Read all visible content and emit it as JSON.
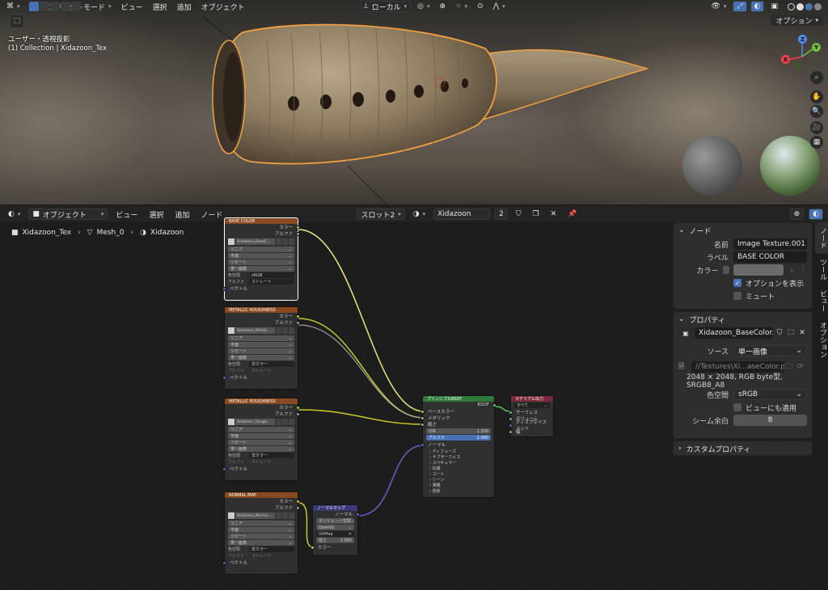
{
  "viewport": {
    "header": {
      "mode": "オブジェクトモード",
      "menus": [
        "ビュー",
        "選択",
        "追加",
        "オブジェクト"
      ],
      "transform_orientation": "ローカル",
      "options": "オプション"
    },
    "view_label": "ユーザー・透視投影",
    "collection_label": "(1) Collection | Xidazoon_Tex",
    "gizmo": {
      "x": "X",
      "y": "Y",
      "z": "Z"
    }
  },
  "node_editor": {
    "header": {
      "editor_type": "オブジェクト",
      "menus": [
        "ビュー",
        "選択",
        "追加",
        "ノード"
      ],
      "slot": "スロット2",
      "material": "Xidazoon",
      "users": "2"
    },
    "breadcrumb": [
      "Xidazoon_Tex",
      "Mesh_0",
      "Xidazoon"
    ],
    "texture_nodes": [
      {
        "title": "BASE COLOR",
        "image": "Xidazoon_BaseC...",
        "colorspace": "sRGB",
        "alpha": "ストレート"
      },
      {
        "title": "METALLIC ROUGHNESS",
        "image": "Xidazoon_Metall...",
        "colorspace": "非カラー",
        "alpha": "ストレート"
      },
      {
        "title": "METALLIC ROUGHNESS",
        "image": "Xidazoon_Rough...",
        "colorspace": "非カラー",
        "alpha": "ストレート"
      },
      {
        "title": "NORMAL MAP",
        "image": "Xidazoon_Norma...",
        "colorspace": "非カラー",
        "alpha": "ストレート"
      }
    ],
    "tex_labels": {
      "color": "カラー",
      "alpha": "アルファ",
      "vector": "ベクトル",
      "linear": "リニア",
      "flat": "平面",
      "repeat": "リピート",
      "single": "単一画像",
      "colorspace_k": "色空間",
      "alpha_k": "アルファ"
    },
    "normal_map": {
      "title": "ノーマルマップ",
      "out": "ノーマル",
      "space": "タンジェント空間",
      "convention": "OpenGL",
      "uv": "UVMap",
      "strength_k": "強さ",
      "strength": "1.000",
      "color": "カラー"
    },
    "bsdf": {
      "title": "プリンシプルBSDF",
      "out": "BSDF",
      "inputs": [
        "ベースカラー",
        "メタリック",
        "粗さ"
      ],
      "ior_k": "IOR",
      "ior": "1.500",
      "alpha_k": "アルファ",
      "alpha": "1.000",
      "normal": "ノーマル",
      "panels": [
        "ディフューズ",
        "サブサーフェス",
        "スペキュラー",
        "伝播",
        "コート",
        "シーン",
        "薄膜",
        "放射"
      ]
    },
    "output": {
      "title": "マテリアル出力",
      "target": "すべて",
      "inputs": [
        "サーフェス",
        "ボリューム",
        "ディスプレイスメント",
        "幅"
      ]
    }
  },
  "sidebar": {
    "node_panel": {
      "title": "ノード",
      "name_k": "名前",
      "name": "Image Texture.001",
      "label_k": "ラベル",
      "label": "BASE COLOR",
      "color_k": "カラー",
      "show_options": "オプションを表示",
      "mute": "ミュート"
    },
    "properties_panel": {
      "title": "プロパティ",
      "image": "Xidazoon_BaseColor....",
      "source_k": "ソース",
      "source": "単一画像",
      "path": "//Textures\\Xi...aseColor.png",
      "info": "2048 × 2048,  RGB byte型, SRGB8_A8",
      "colorspace_k": "色空間",
      "colorspace": "sRGB",
      "view_as_render": "ビューにも適用",
      "margin_k": "シーム余白",
      "margin": "8"
    },
    "custom_props": "カスタムプロパティ",
    "tabs": [
      "ノード",
      "ツール",
      "ビュー",
      "オプション"
    ]
  }
}
